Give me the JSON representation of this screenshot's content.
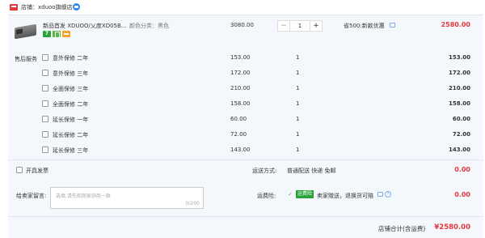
{
  "store": {
    "label": "店铺：xduoo旗舰店",
    "logo_icon": "store-icon",
    "chat_icon": "chat-bubble-icon"
  },
  "product": {
    "title": "新品首发 XDUOO/乂度XD05B...",
    "attribute": "颜色分类：黑色",
    "badges": [
      "7",
      "gift-icon",
      "card-icon"
    ],
    "price": "3080.00",
    "quantity": "1",
    "minus_label": "−",
    "plus_label": "+",
    "promo": "省500:新款优惠",
    "total": "2580.00"
  },
  "services": {
    "section_label": "售后服务",
    "items": [
      {
        "label": "意外保修 二年",
        "price": "153.00",
        "qty": "1",
        "total": "153.00"
      },
      {
        "label": "意外保修 三年",
        "price": "172.00",
        "qty": "1",
        "total": "172.00"
      },
      {
        "label": "全面保修 三年",
        "price": "210.00",
        "qty": "1",
        "total": "210.00"
      },
      {
        "label": "全面保修 二年",
        "price": "158.00",
        "qty": "1",
        "total": "158.00"
      },
      {
        "label": "延长保修 一年",
        "price": "60.00",
        "qty": "1",
        "total": "60.00"
      },
      {
        "label": "延长保修 二年",
        "price": "72.00",
        "qty": "1",
        "total": "72.00"
      },
      {
        "label": "延长保修 三年",
        "price": "143.00",
        "qty": "1",
        "total": "143.00"
      }
    ]
  },
  "invoice": {
    "label": "开具发票"
  },
  "shipping": {
    "label": "运送方式:",
    "value": "普通配送 快递 免邮",
    "fee": "0.00"
  },
  "message": {
    "label": "给卖家留言:",
    "placeholder": "选填,请先和商家协商一致",
    "counter": "0/200"
  },
  "insurance": {
    "label": "运费险:",
    "badge": "运费险",
    "text": "卖家赠送，退换货可赔",
    "fee": "0.00"
  },
  "grand_total": {
    "label": "店铺合计(含运费)",
    "value": "¥2580.00"
  },
  "colors": {
    "accent_red": "#e4393c",
    "panel_bg": "#f4f8fd",
    "badge_green": "#29a33b"
  }
}
